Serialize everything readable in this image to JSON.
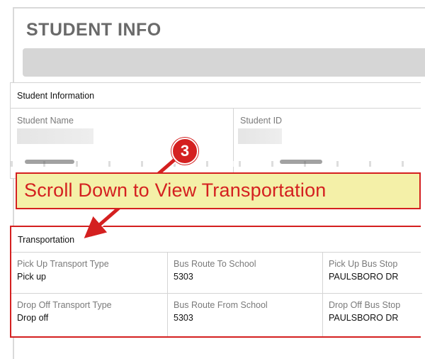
{
  "page": {
    "title": "STUDENT INFO"
  },
  "student_info": {
    "header": "Student Information",
    "fields": [
      {
        "label": "Student Name"
      },
      {
        "label": "Student ID"
      }
    ]
  },
  "callout": {
    "step_number": "3",
    "text": "Scroll Down to View Transportation",
    "color": "#d42020",
    "background": "#f4f0a8"
  },
  "transportation": {
    "header": "Transportation",
    "rows": [
      [
        {
          "label": "Pick Up Transport Type",
          "value": "Pick up"
        },
        {
          "label": "Bus Route To School",
          "value": "5303"
        },
        {
          "label": "Pick Up Bus Stop",
          "value": "PAULSBORO DR"
        }
      ],
      [
        {
          "label": "Drop Off Transport Type",
          "value": "Drop off"
        },
        {
          "label": "Bus Route From School",
          "value": "5303"
        },
        {
          "label": "Drop Off Bus Stop",
          "value": "PAULSBORO DR"
        }
      ]
    ]
  }
}
